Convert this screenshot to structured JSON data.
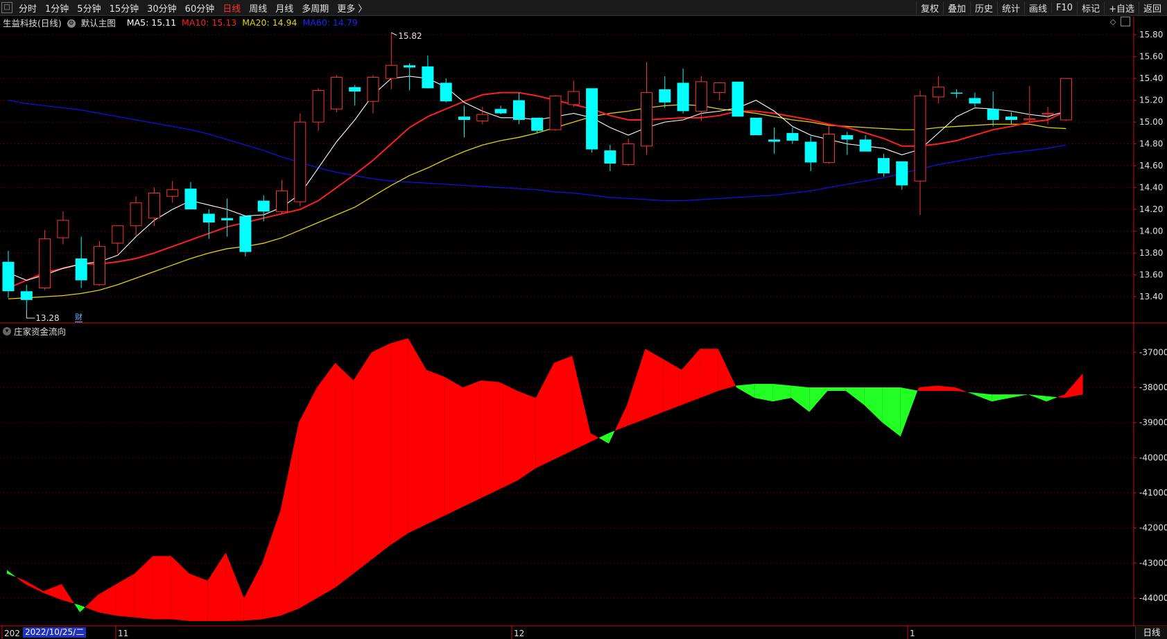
{
  "topbar": {
    "mini_icon": "□",
    "periods": [
      "分时",
      "1分钟",
      "5分钟",
      "15分钟",
      "30分钟",
      "60分钟",
      "日线",
      "周线",
      "月线",
      "多周期",
      "更多 〉"
    ],
    "active_period": "日线",
    "tools": [
      "复权",
      "叠加",
      "历史",
      "统计",
      "画线",
      "F10",
      "标记",
      "+自选",
      "返回"
    ]
  },
  "info": {
    "stock": "生益科技(日线)",
    "template": "默认主图",
    "ma5": "MA5: 15.11",
    "ma10": "MA10: 15.13",
    "ma20": "MA20: 14.94",
    "ma60": "MA60: 14.79"
  },
  "colors": {
    "up": "#ff3232",
    "down": "#00ffff",
    "ma5": "#ffffff",
    "ma10": "#ff2020",
    "ma20": "#e6d200",
    "ma60": "#1010e0",
    "flow_red": "#ff0000",
    "flow_green": "#22ff22",
    "axis": "#cc1010"
  },
  "price_axis": {
    "ticks": [
      "15.80",
      "15.60",
      "15.40",
      "15.20",
      "15.00",
      "14.80",
      "14.60",
      "14.40",
      "14.20",
      "14.00",
      "13.80",
      "13.60",
      "13.40"
    ]
  },
  "annotations": {
    "high_label": "15.82",
    "low_label": "13.28",
    "finance_badge": "财"
  },
  "indicator": {
    "title": "庄家资金流向",
    "ticks": [
      "-37000",
      "-38000",
      "-39000",
      "-40000",
      "-41000",
      "-42000",
      "-43000",
      "-44000"
    ]
  },
  "x_axis": {
    "labels": [
      "202",
      "11",
      "12",
      "1"
    ],
    "selected_date": "2022/10/25/二",
    "mode_label": "日线"
  },
  "chart_data": {
    "type": "candlestick",
    "candles": [
      {
        "o": 13.72,
        "h": 13.82,
        "l": 13.39,
        "c": 13.45
      },
      {
        "o": 13.45,
        "h": 13.51,
        "l": 13.28,
        "c": 13.37
      },
      {
        "o": 13.48,
        "h": 14.01,
        "l": 13.46,
        "c": 13.93
      },
      {
        "o": 13.94,
        "h": 14.18,
        "l": 13.88,
        "c": 14.1
      },
      {
        "o": 13.75,
        "h": 13.95,
        "l": 13.48,
        "c": 13.55
      },
      {
        "o": 13.51,
        "h": 13.91,
        "l": 13.5,
        "c": 13.86
      },
      {
        "o": 13.89,
        "h": 14.05,
        "l": 13.8,
        "c": 14.05
      },
      {
        "o": 14.05,
        "h": 14.32,
        "l": 13.96,
        "c": 14.26
      },
      {
        "o": 14.12,
        "h": 14.4,
        "l": 14.05,
        "c": 14.35
      },
      {
        "o": 14.32,
        "h": 14.46,
        "l": 14.26,
        "c": 14.38
      },
      {
        "o": 14.39,
        "h": 14.45,
        "l": 14.28,
        "c": 14.2
      },
      {
        "o": 14.16,
        "h": 14.2,
        "l": 13.93,
        "c": 14.08
      },
      {
        "o": 14.12,
        "h": 14.3,
        "l": 13.95,
        "c": 14.1
      },
      {
        "o": 14.14,
        "h": 14.14,
        "l": 13.77,
        "c": 13.81
      },
      {
        "o": 14.28,
        "h": 14.33,
        "l": 14.09,
        "c": 14.18
      },
      {
        "o": 14.18,
        "h": 14.47,
        "l": 14.16,
        "c": 14.37
      },
      {
        "o": 14.27,
        "h": 15.08,
        "l": 14.23,
        "c": 15.0
      },
      {
        "o": 15.0,
        "h": 15.31,
        "l": 14.92,
        "c": 15.29
      },
      {
        "o": 15.12,
        "h": 15.43,
        "l": 15.09,
        "c": 15.41
      },
      {
        "o": 15.32,
        "h": 15.34,
        "l": 15.15,
        "c": 15.28
      },
      {
        "o": 15.19,
        "h": 15.43,
        "l": 15.08,
        "c": 15.41
      },
      {
        "o": 15.4,
        "h": 15.82,
        "l": 15.3,
        "c": 15.52
      },
      {
        "o": 15.52,
        "h": 15.54,
        "l": 15.29,
        "c": 15.5
      },
      {
        "o": 15.51,
        "h": 15.61,
        "l": 15.33,
        "c": 15.31
      },
      {
        "o": 15.36,
        "h": 15.4,
        "l": 15.18,
        "c": 15.19
      },
      {
        "o": 15.05,
        "h": 15.15,
        "l": 14.86,
        "c": 15.02
      },
      {
        "o": 15.01,
        "h": 15.14,
        "l": 14.98,
        "c": 15.07
      },
      {
        "o": 15.12,
        "h": 15.15,
        "l": 15.07,
        "c": 15.08
      },
      {
        "o": 15.2,
        "h": 15.27,
        "l": 14.98,
        "c": 15.02
      },
      {
        "o": 15.04,
        "h": 15.04,
        "l": 14.9,
        "c": 14.92
      },
      {
        "o": 14.93,
        "h": 15.25,
        "l": 14.92,
        "c": 15.24
      },
      {
        "o": 15.16,
        "h": 15.38,
        "l": 15.14,
        "c": 15.28
      },
      {
        "o": 15.31,
        "h": 15.31,
        "l": 14.72,
        "c": 14.75
      },
      {
        "o": 14.74,
        "h": 14.79,
        "l": 14.55,
        "c": 14.62
      },
      {
        "o": 14.61,
        "h": 14.85,
        "l": 14.6,
        "c": 14.8
      },
      {
        "o": 14.78,
        "h": 15.55,
        "l": 14.7,
        "c": 15.27
      },
      {
        "o": 15.3,
        "h": 15.42,
        "l": 15.13,
        "c": 15.18
      },
      {
        "o": 15.36,
        "h": 15.49,
        "l": 15.08,
        "c": 15.1
      },
      {
        "o": 15.1,
        "h": 15.42,
        "l": 15.01,
        "c": 15.37
      },
      {
        "o": 15.27,
        "h": 15.35,
        "l": 15.2,
        "c": 15.36
      },
      {
        "o": 15.37,
        "h": 15.37,
        "l": 15.05,
        "c": 15.05
      },
      {
        "o": 15.04,
        "h": 15.04,
        "l": 14.88,
        "c": 14.88
      },
      {
        "o": 14.84,
        "h": 14.95,
        "l": 14.71,
        "c": 14.82
      },
      {
        "o": 14.9,
        "h": 14.95,
        "l": 14.8,
        "c": 14.83
      },
      {
        "o": 14.82,
        "h": 14.87,
        "l": 14.55,
        "c": 14.63
      },
      {
        "o": 14.63,
        "h": 14.96,
        "l": 14.62,
        "c": 14.89
      },
      {
        "o": 14.88,
        "h": 14.91,
        "l": 14.7,
        "c": 14.84
      },
      {
        "o": 14.84,
        "h": 14.88,
        "l": 14.73,
        "c": 14.73
      },
      {
        "o": 14.67,
        "h": 14.71,
        "l": 14.5,
        "c": 14.53
      },
      {
        "o": 14.64,
        "h": 14.64,
        "l": 14.38,
        "c": 14.42
      },
      {
        "o": 14.46,
        "h": 15.29,
        "l": 14.15,
        "c": 15.24
      },
      {
        "o": 15.23,
        "h": 15.42,
        "l": 15.17,
        "c": 15.32
      },
      {
        "o": 15.27,
        "h": 15.3,
        "l": 15.22,
        "c": 15.26
      },
      {
        "o": 15.22,
        "h": 15.27,
        "l": 15.14,
        "c": 15.17
      },
      {
        "o": 15.12,
        "h": 15.28,
        "l": 14.96,
        "c": 15.02
      },
      {
        "o": 15.05,
        "h": 15.09,
        "l": 14.98,
        "c": 15.02
      },
      {
        "o": 15.03,
        "h": 15.33,
        "l": 15.0,
        "c": 15.03
      },
      {
        "o": 15.08,
        "h": 15.14,
        "l": 14.98,
        "c": 15.08
      },
      {
        "o": 15.02,
        "h": 15.4,
        "l": 15.01,
        "c": 15.4
      }
    ],
    "ma5": [
      13.62,
      13.55,
      13.6,
      13.66,
      13.7,
      13.72,
      13.78,
      13.95,
      14.1,
      14.2,
      14.28,
      14.24,
      14.2,
      14.14,
      14.15,
      14.22,
      14.34,
      14.58,
      14.82,
      15.02,
      15.25,
      15.4,
      15.42,
      15.4,
      15.32,
      15.18,
      15.1,
      15.04,
      15.04,
      15.02,
      15.05,
      15.08,
      15.04,
      14.95,
      14.88,
      14.95,
      15.0,
      15.02,
      15.08,
      15.1,
      15.13,
      15.2,
      15.1,
      14.96,
      14.88,
      14.84,
      14.8,
      14.78,
      14.76,
      14.7,
      14.75,
      14.9,
      15.05,
      15.13,
      15.12,
      15.1,
      15.07,
      15.05,
      15.1
    ],
    "ma10": [
      13.48,
      13.55,
      13.62,
      13.66,
      13.7,
      13.7,
      13.72,
      13.75,
      13.8,
      13.86,
      13.92,
      13.98,
      14.04,
      14.08,
      14.12,
      14.16,
      14.2,
      14.28,
      14.4,
      14.52,
      14.65,
      14.8,
      14.95,
      15.05,
      15.12,
      15.19,
      15.25,
      15.27,
      15.27,
      15.24,
      15.2,
      15.16,
      15.12,
      15.06,
      15.02,
      15.02,
      15.03,
      15.04,
      15.04,
      15.06,
      15.1,
      15.1,
      15.08,
      15.05,
      15.02,
      14.98,
      14.95,
      14.9,
      14.85,
      14.78,
      14.78,
      14.8,
      14.83,
      14.88,
      14.93,
      14.96,
      15.0,
      15.02,
      15.1
    ],
    "ma20": [
      13.38,
      13.39,
      13.4,
      13.41,
      13.43,
      13.46,
      13.51,
      13.57,
      13.63,
      13.69,
      13.75,
      13.8,
      13.84,
      13.86,
      13.89,
      13.94,
      14.01,
      14.08,
      14.15,
      14.22,
      14.32,
      14.42,
      14.51,
      14.58,
      14.66,
      14.73,
      14.79,
      14.83,
      14.86,
      14.9,
      14.95,
      15.0,
      15.05,
      15.08,
      15.1,
      15.13,
      15.15,
      15.16,
      15.15,
      15.12,
      15.1,
      15.08,
      15.05,
      15.02,
      15.0,
      14.97,
      14.96,
      14.95,
      14.94,
      14.93,
      14.93,
      14.95,
      14.96,
      14.97,
      14.98,
      14.98,
      14.98,
      14.95,
      14.94
    ],
    "ma60": [
      15.2,
      15.17,
      15.15,
      15.13,
      15.11,
      15.08,
      15.05,
      15.02,
      14.99,
      14.96,
      14.93,
      14.89,
      14.84,
      14.79,
      14.74,
      14.68,
      14.63,
      14.58,
      14.54,
      14.51,
      14.48,
      14.46,
      14.45,
      14.44,
      14.43,
      14.42,
      14.41,
      14.4,
      14.39,
      14.38,
      14.36,
      14.35,
      14.33,
      14.31,
      14.3,
      14.29,
      14.28,
      14.28,
      14.29,
      14.3,
      14.31,
      14.32,
      14.33,
      14.35,
      14.37,
      14.4,
      14.43,
      14.46,
      14.49,
      14.53,
      14.57,
      14.61,
      14.64,
      14.67,
      14.7,
      14.72,
      14.74,
      14.76,
      14.79
    ],
    "flow_a": [
      -43300,
      -43500,
      -43800,
      -43600,
      -44400,
      -43900,
      -43600,
      -43300,
      -42800,
      -42800,
      -43300,
      -43500,
      -42700,
      -44000,
      -43000,
      -41500,
      -39000,
      -38000,
      -37300,
      -37800,
      -37000,
      -36750,
      -36600,
      -37500,
      -37700,
      -38000,
      -37800,
      -37850,
      -38100,
      -38300,
      -37300,
      -37100,
      -39300,
      -39600,
      -38500,
      -36900,
      -37200,
      -37500,
      -36900,
      -36900,
      -38000,
      -38300,
      -38400,
      -38300,
      -38700,
      -38100,
      -38100,
      -38500,
      -39000,
      -39400,
      -38000,
      -37950,
      -38000,
      -38200,
      -38400,
      -38300,
      -38200,
      -38400,
      -38200,
      -37600
    ],
    "flow_b": [
      -43200,
      -43600,
      -43850,
      -44050,
      -44200,
      -44400,
      -44500,
      -44550,
      -44600,
      -44600,
      -44650,
      -44650,
      -44650,
      -44640,
      -44600,
      -44500,
      -44300,
      -44000,
      -43700,
      -43300,
      -42900,
      -42500,
      -42150,
      -41900,
      -41650,
      -41400,
      -41150,
      -40900,
      -40650,
      -40300,
      -40050,
      -39800,
      -39550,
      -39300,
      -39100,
      -38900,
      -38700,
      -38500,
      -38300,
      -38100,
      -37950,
      -37900,
      -37900,
      -37950,
      -38000,
      -38000,
      -38000,
      -38000,
      -38000,
      -38000,
      -38100,
      -38100,
      -38100,
      -38150,
      -38200,
      -38200,
      -38200,
      -38250,
      -38300,
      -38200
    ]
  }
}
